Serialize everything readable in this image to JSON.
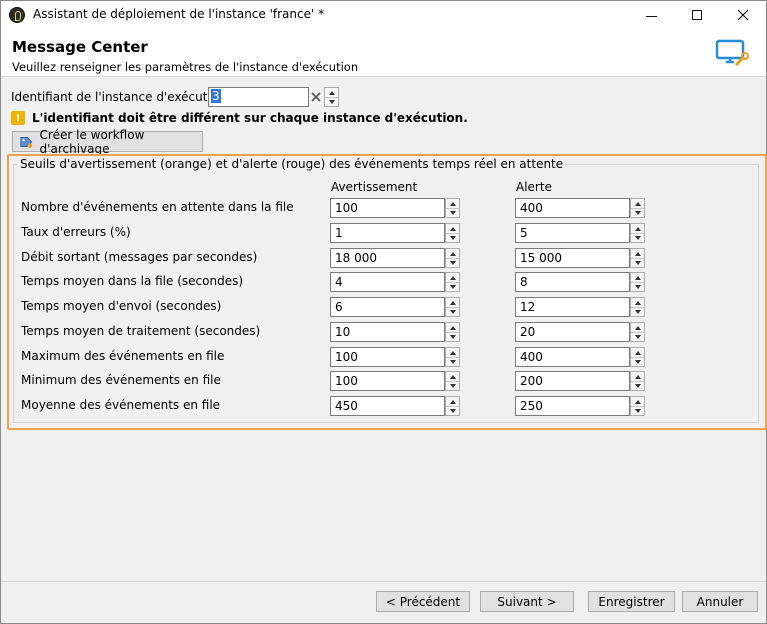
{
  "window": {
    "title": "Assistant de déploiement de l'instance 'france' *"
  },
  "header": {
    "title": "Message Center",
    "subtitle": "Veuillez renseigner les paramètres de l'instance d'exécution"
  },
  "identifier": {
    "label": "Identifiant de l'instance d'exécution :",
    "value": "3"
  },
  "warning": {
    "text": "L'identifiant doit être différent sur chaque instance d'exécution."
  },
  "archive_button": {
    "label": "Créer le workflow d'archivage"
  },
  "thresholds": {
    "legend": "Seuils d'avertissement (orange) et d'alerte (rouge) des événements temps réel en attente",
    "col_warning": "Avertissement",
    "col_alert": "Alerte",
    "rows": [
      {
        "label": "Nombre d'événements en attente dans la file",
        "warning": "100",
        "alert": "400"
      },
      {
        "label": "Taux d'erreurs (%)",
        "warning": "1",
        "alert": "5"
      },
      {
        "label": "Débit sortant (messages par secondes)",
        "warning": "18 000",
        "alert": "15 000"
      },
      {
        "label": "Temps moyen dans la file (secondes)",
        "warning": "4",
        "alert": "8"
      },
      {
        "label": "Temps moyen d'envoi (secondes)",
        "warning": "6",
        "alert": "12"
      },
      {
        "label": "Temps moyen de traitement (secondes)",
        "warning": "10",
        "alert": "20"
      },
      {
        "label": "Maximum des événements en file",
        "warning": "100",
        "alert": "400"
      },
      {
        "label": "Minimum des événements en file",
        "warning": "100",
        "alert": "200"
      },
      {
        "label": "Moyenne des événements en file",
        "warning": "450",
        "alert": "250"
      }
    ]
  },
  "footer": {
    "prev": "< Précédent",
    "next": "Suivant >",
    "save": "Enregistrer",
    "cancel": "Annuler"
  }
}
